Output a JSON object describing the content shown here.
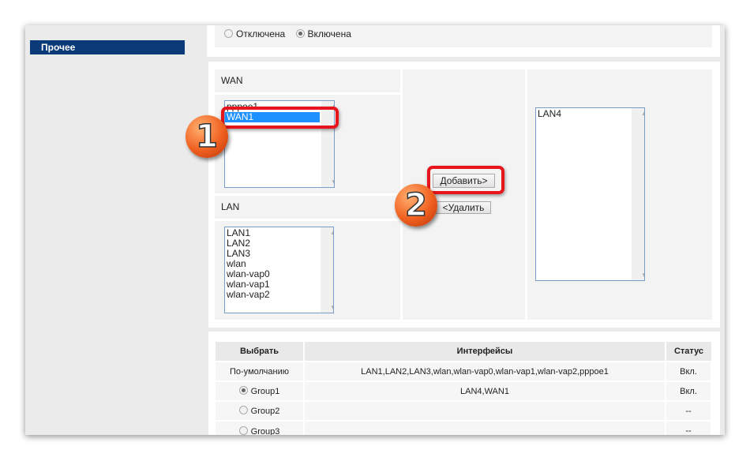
{
  "sidebar": {
    "active_item": "Прочее"
  },
  "status_radio": {
    "off_label": "Отключена",
    "on_label": "Включена",
    "selected": "on"
  },
  "wan": {
    "label": "WAN",
    "items": [
      "pppoe1",
      "WAN1"
    ],
    "selected": "WAN1"
  },
  "lan": {
    "label": "LAN",
    "items": [
      "LAN1",
      "LAN2",
      "LAN3",
      "wlan",
      "wlan-vap0",
      "wlan-vap1",
      "wlan-vap2"
    ]
  },
  "group_list": {
    "items": [
      "LAN4"
    ]
  },
  "buttons": {
    "add": "Добавить>",
    "remove": "<Удалить"
  },
  "badges": {
    "step1": "1",
    "step2": "2"
  },
  "table": {
    "headers": [
      "Выбрать",
      "Интерфейсы",
      "Статус"
    ],
    "rows": [
      {
        "select": "По-умолчанию",
        "interfaces": "LAN1,LAN2,LAN3,wlan,wlan-vap0,wlan-vap1,wlan-vap2,pppoe1",
        "status": "Вкл.",
        "radio": false
      },
      {
        "select": "Group1",
        "interfaces": "LAN4,WAN1",
        "status": "Вкл.",
        "radio": true,
        "checked": true
      },
      {
        "select": "Group2",
        "interfaces": "",
        "status": "--",
        "radio": true,
        "checked": false
      },
      {
        "select": "Group3",
        "interfaces": "",
        "status": "--",
        "radio": true,
        "checked": false
      }
    ]
  },
  "colors": {
    "menu_active": "#0a3a78",
    "highlight": "#e8141b",
    "selection": "#1e90ff"
  }
}
